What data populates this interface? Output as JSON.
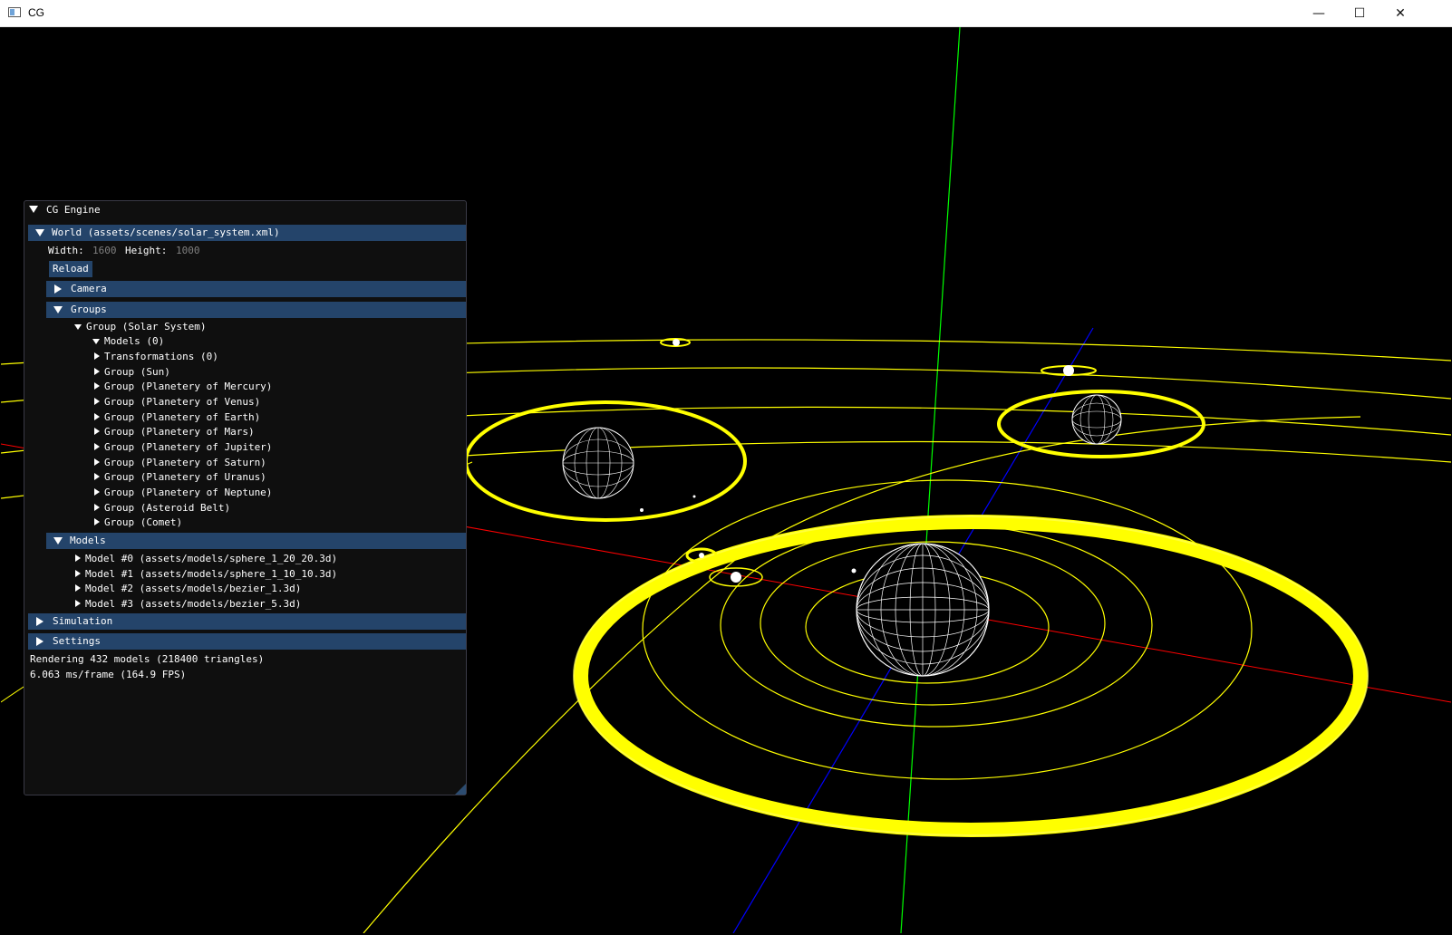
{
  "window": {
    "title": "CG",
    "minimize_glyph": "—",
    "maximize_glyph": "☐",
    "close_glyph": "✕"
  },
  "panel": {
    "title": "CG Engine",
    "world_header": "World (assets/scenes/solar_system.xml)",
    "width_label": "Width:",
    "width_value": "1600",
    "height_label": "Height:",
    "height_value": "1000",
    "reload_label": "Reload",
    "camera_header": "Camera",
    "groups_header": "Groups",
    "root_group": "Group (Solar System)",
    "group_items": [
      "Models (0)",
      "Transformations (0)",
      "Group (Sun)",
      "Group (Planetery of Mercury)",
      "Group (Planetery of Venus)",
      "Group (Planetery of Earth)",
      "Group (Planetery of Mars)",
      "Group (Planetery of Jupiter)",
      "Group (Planetery of Saturn)",
      "Group (Planetery of Uranus)",
      "Group (Planetery of Neptune)",
      "Group (Asteroid Belt)",
      "Group (Comet)"
    ],
    "models_header": "Models",
    "model_items": [
      "Model #0 (assets/models/sphere_1_20_20.3d)",
      "Model #1 (assets/models/sphere_1_10_10.3d)",
      "Model #2 (assets/models/bezier_1.3d)",
      "Model #3 (assets/models/bezier_5.3d)"
    ],
    "simulation_header": "Simulation",
    "settings_header": "Settings",
    "stats_line1": "Rendering 432 models (218400 triangles)",
    "stats_line2": "6.063 ms/frame (164.9 FPS)"
  },
  "scene_colors": {
    "orbit": "#ffff00",
    "x_axis": "#ff0000",
    "y_axis": "#00ff00",
    "z_axis": "#0000ff",
    "wireframe": "#ffffff",
    "background": "#000000"
  }
}
